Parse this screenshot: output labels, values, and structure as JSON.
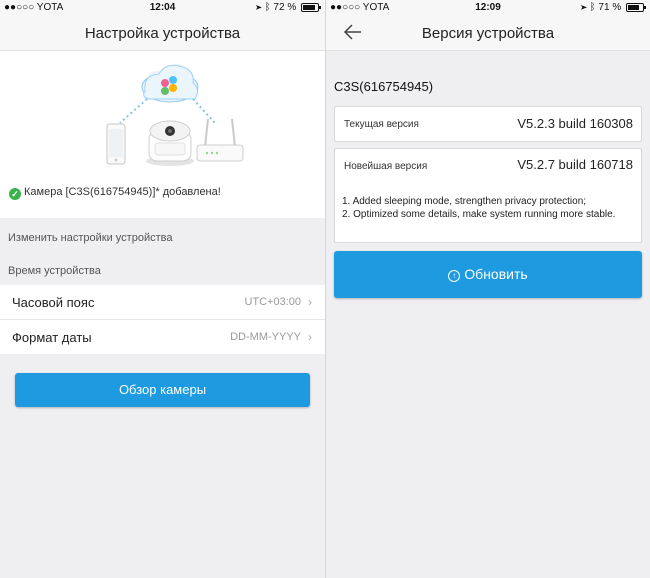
{
  "left": {
    "status": {
      "carrier": "●●○○○ YOTA",
      "time": "12:04",
      "battery": "72 %",
      "battery_level": 0.72
    },
    "title": "Настройка устройства",
    "added_message": "Камера [C3S(616754945)]* добавлена!",
    "section_change": "Изменить настройки устройства",
    "section_time": "Время устройства",
    "rows": [
      {
        "label": "Часовой пояс",
        "value": "UTC+03:00"
      },
      {
        "label": "Формат даты",
        "value": "DD-MM-YYYY"
      }
    ],
    "button": "Обзор камеры",
    "colors": {
      "accent": "#1e9ae0",
      "success": "#3bb34a"
    }
  },
  "right": {
    "status": {
      "carrier": "●●○○○ YOTA",
      "time": "12:09",
      "battery": "71 %",
      "battery_level": 0.71
    },
    "title": "Версия устройства",
    "device": "C3S(616754945)",
    "current": {
      "label": "Текущая версия",
      "value": "V5.2.3 build 160308"
    },
    "latest": {
      "label": "Новейшая версия",
      "value": "V5.2.7 build 160718",
      "notes": [
        "1. Added sleeping mode, strengthen privacy protection;",
        "2. Optimized some details, make system running more stable."
      ]
    },
    "button": "Обновить"
  }
}
